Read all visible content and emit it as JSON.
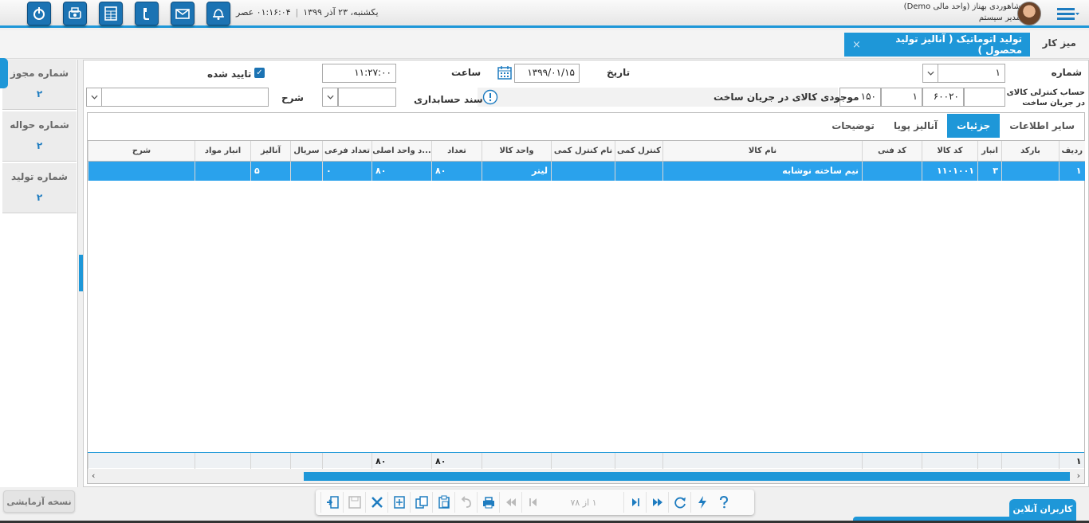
{
  "topbar": {
    "date_text": "یکشنبه، ۲۳ آذر ۱۳۹۹",
    "time_text": "۰۱:۱۶:۰۴ عصر",
    "user_name": "شاهوردی بهناز (واحد مالی Demo)",
    "user_role": "مدیر سیستم",
    "icons": [
      "power-icon",
      "print-server-icon",
      "calculator-icon",
      "phone-icon",
      "mail-icon",
      "bell-icon"
    ]
  },
  "tabs": {
    "home": "میز کار",
    "active": "تولید اتوماتیک ( آنالیز تولید محصول )",
    "close": "×"
  },
  "side": [
    {
      "label": "شماره مجوز",
      "value": "۲"
    },
    {
      "label": "شماره حواله",
      "value": "۲"
    },
    {
      "label": "شماره تولید",
      "value": "۲"
    }
  ],
  "form": {
    "number_label": "شماره",
    "number_value": "۱",
    "date_label": "تاریخ",
    "date_value": "۱۳۹۹/۰۱/۱۵",
    "time_label": "ساعت",
    "time_value": "۱۱:۲۷:۰۰",
    "approved_label": "تایید شده",
    "control_account_label": "حساب کنترلی کالای در جریان ساخت",
    "control_account_values": [
      "",
      "۶۰۰۲۰",
      "۱",
      "۱۵۰"
    ],
    "wip_stock_label": "موجودی کالای در جریان ساخت",
    "voucher_label": "سند حسابداری",
    "voucher_value": "",
    "desc_label": "شرح",
    "desc_value": ""
  },
  "subtabs": [
    "سایر اطلاعات",
    "جزئیات",
    "آنالیز پویا",
    "توضیحات"
  ],
  "grid": {
    "columns": [
      "ردیف",
      "بارکد",
      "انبار",
      "کد کالا",
      "کد فنی",
      "نام کالا",
      "کنترل کمی",
      "نام کنترل کمی",
      "واحد کالا",
      "تعداد",
      "...د واحد اصلی",
      "تعداد فرعی",
      "سریال",
      "آنالیز",
      "انبار مواد",
      "شرح"
    ],
    "rows": [
      [
        "۱",
        "",
        "۳",
        "۱۱۰۱۰۰۱",
        "",
        "نیم ساخته نوشابه",
        "",
        "",
        "لیتر",
        "۸۰",
        "۸۰",
        "۰",
        "",
        "۵",
        "",
        ""
      ]
    ],
    "footer": [
      "۱",
      "",
      "",
      "",
      "",
      "",
      "",
      "",
      "",
      "۸۰",
      "۸۰",
      "",
      "",
      "",
      "",
      ""
    ]
  },
  "bottom": {
    "trial_label": "نسخه آزمایشی",
    "pager": "۱ از ۷۸",
    "online_label": "کاربران آنلاین"
  }
}
